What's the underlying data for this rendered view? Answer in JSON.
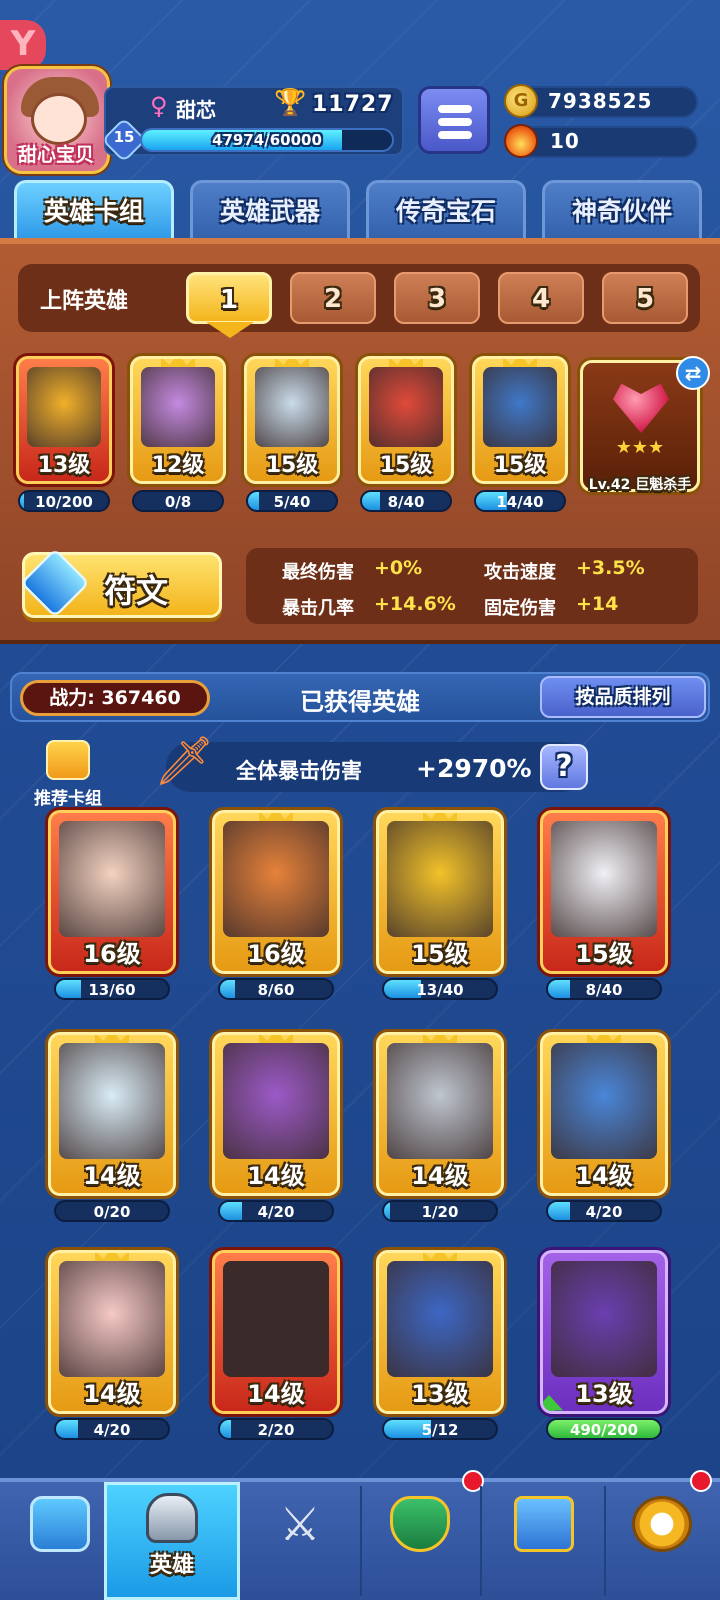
{
  "header": {
    "corner_logo": "Y",
    "avatar_name": "甜心宝贝",
    "player_name": "甜芯",
    "gender_symbol": "♀",
    "trophies": "11727",
    "level": "15",
    "xp_text": "47974/60000",
    "xp_fraction": 0.8,
    "gold": "7938525",
    "energy": "10"
  },
  "top_tabs": [
    {
      "label": "英雄卡组",
      "active": true
    },
    {
      "label": "英雄武器",
      "active": false
    },
    {
      "label": "传奇宝石",
      "active": false
    },
    {
      "label": "神奇伙伴",
      "active": false
    }
  ],
  "lineup": {
    "label": "上阵英雄",
    "slots": [
      "1",
      "2",
      "3",
      "4",
      "5"
    ],
    "active_slot": "1",
    "heroes": [
      {
        "level": "13级",
        "progress": "10/200",
        "fraction": 0.05,
        "frame": "red",
        "color": "#f0b02a"
      },
      {
        "level": "12级",
        "progress": "0/8",
        "fraction": 0,
        "frame": "gold",
        "color": "#c48ae0"
      },
      {
        "level": "15级",
        "progress": "5/40",
        "fraction": 0.125,
        "frame": "gold",
        "color": "#c9dcea"
      },
      {
        "level": "15级",
        "progress": "8/40",
        "fraction": 0.2,
        "frame": "gold",
        "color": "#e04a3a"
      },
      {
        "level": "15级",
        "progress": "14/40",
        "fraction": 0.35,
        "frame": "gold",
        "color": "#3f78c8"
      }
    ],
    "relic": {
      "label": "Lv.42 巨魁杀手",
      "stars": "★★★"
    },
    "swap_icon": "⇄"
  },
  "rune": {
    "label": "符文"
  },
  "stats": [
    {
      "name": "最终伤害",
      "value": "+0%"
    },
    {
      "name": "攻击速度",
      "value": "+3.5%"
    },
    {
      "name": "暴击几率",
      "value": "+14.6%"
    },
    {
      "name": "固定伤害",
      "value": "+14"
    }
  ],
  "owned": {
    "power": "战力: 367460",
    "title": "已获得英雄",
    "sort_label": "按品质排列",
    "recommend_label": "推荐卡组",
    "crit_label": "全体暴击伤害",
    "crit_value": "+2970%",
    "help": "?",
    "heroes": [
      {
        "level": "16级",
        "progress": "13/60",
        "fraction": 0.22,
        "frame": "red",
        "color": "#f3d2c0"
      },
      {
        "level": "16级",
        "progress": "8/60",
        "fraction": 0.13,
        "frame": "gold",
        "color": "#e6823a"
      },
      {
        "level": "15级",
        "progress": "13/40",
        "fraction": 0.33,
        "frame": "gold",
        "color": "#f2c22a"
      },
      {
        "level": "15级",
        "progress": "8/40",
        "fraction": 0.2,
        "frame": "red",
        "color": "#f0f0f5"
      },
      {
        "level": "14级",
        "progress": "0/20",
        "fraction": 0,
        "frame": "gold",
        "color": "#d9ecf6"
      },
      {
        "level": "14级",
        "progress": "4/20",
        "fraction": 0.2,
        "frame": "gold",
        "color": "#9c5ac8"
      },
      {
        "level": "14级",
        "progress": "1/20",
        "fraction": 0.05,
        "frame": "gold",
        "color": "#bfc6cf"
      },
      {
        "level": "14级",
        "progress": "4/20",
        "fraction": 0.2,
        "frame": "gold",
        "color": "#4a86d8"
      },
      {
        "level": "14级",
        "progress": "4/20",
        "fraction": 0.2,
        "frame": "gold",
        "color": "#f6c9c6"
      },
      {
        "level": "14级",
        "progress": "2/20",
        "fraction": 0.1,
        "frame": "red",
        "color": "#3a2a2a"
      },
      {
        "level": "13级",
        "progress": "5/12",
        "fraction": 0.42,
        "frame": "gold",
        "color": "#3d67c4"
      },
      {
        "level": "13级",
        "progress": "490/200",
        "fraction": 1,
        "frame": "purple",
        "color": "#6a3fb0"
      }
    ]
  },
  "nav": [
    {
      "icon": "treasure-chest-icon",
      "label": "",
      "active": false,
      "badge": false
    },
    {
      "icon": "knight-helmet-icon",
      "label": "英雄",
      "active": true,
      "badge": false
    },
    {
      "icon": "crossed-swords-icon",
      "label": "",
      "active": false,
      "badge": false
    },
    {
      "icon": "crown-shield-icon",
      "label": "",
      "active": false,
      "badge": true
    },
    {
      "icon": "guild-banner-icon",
      "label": "",
      "active": false,
      "badge": false
    },
    {
      "icon": "compass-icon",
      "label": "",
      "active": false,
      "badge": true
    }
  ]
}
